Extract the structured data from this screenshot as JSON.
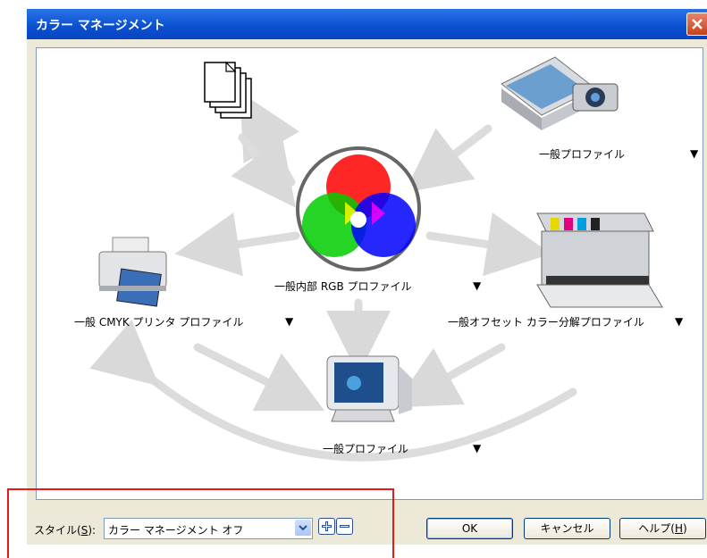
{
  "window": {
    "title": "カラー マネージメント",
    "close_icon": "close-icon"
  },
  "diagram": {
    "center": {
      "label": "一般内部 RGB プロファイル",
      "dropdown": "▼"
    },
    "top_right": {
      "label": "一般プロファイル",
      "dropdown": "▼"
    },
    "left": {
      "label": "一般 CMYK プリンタ プロファイル",
      "dropdown": "▼"
    },
    "right": {
      "label": "一般オフセット カラー分解プロファイル",
      "dropdown": "▼"
    },
    "bottom": {
      "label": "一般プロファイル",
      "dropdown": "▼"
    }
  },
  "bottombar": {
    "style_label_prefix": "スタイル(",
    "style_label_key": "S",
    "style_label_suffix": "):",
    "style_value": "カラー マネージメント オフ",
    "add_icon": "add-icon",
    "remove_icon": "remove-icon",
    "ok_label": "OK",
    "cancel_label": "キャンセル",
    "help_prefix": "ヘルプ(",
    "help_key": "H",
    "help_suffix": ")"
  },
  "colors": {
    "title_bar": "#0a4fd0",
    "highlight_box": "#e31b1b",
    "dialog_bg": "#ece9d8"
  }
}
